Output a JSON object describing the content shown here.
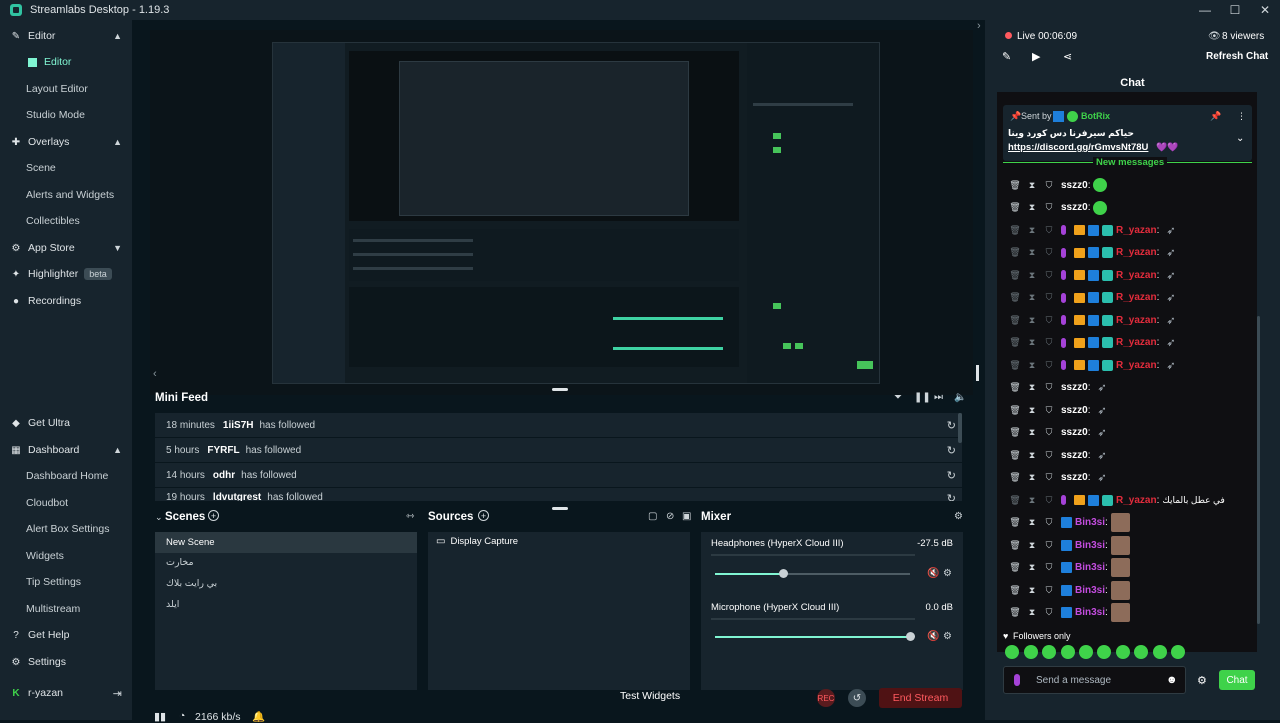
{
  "app": {
    "title": "Streamlabs Desktop - 1.19.3"
  },
  "sidebar": {
    "editor": "Editor",
    "editor_sub": "Editor",
    "layout_editor": "Layout Editor",
    "studio_mode": "Studio Mode",
    "overlays": "Overlays",
    "scene": "Scene",
    "alerts_widgets": "Alerts and Widgets",
    "collectibles": "Collectibles",
    "app_store": "App Store",
    "highlighter": "Highlighter",
    "highlighter_badge": "beta",
    "recordings": "Recordings",
    "get_ultra": "Get Ultra",
    "dashboard": "Dashboard",
    "dashboard_home": "Dashboard Home",
    "cloudbot": "Cloudbot",
    "alert_box": "Alert Box Settings",
    "widgets": "Widgets",
    "tip_settings": "Tip Settings",
    "multistream": "Multistream",
    "get_help": "Get Help",
    "settings": "Settings",
    "user": "r-yazan"
  },
  "minifeed": {
    "title": "Mini Feed",
    "rows": [
      {
        "time": "18 minutes",
        "user": "1iiS7H",
        "action": "has followed"
      },
      {
        "time": "5 hours",
        "user": "FYRFL",
        "action": "has followed"
      },
      {
        "time": "14 hours",
        "user": "odhr",
        "action": "has followed"
      },
      {
        "time": "19 hours",
        "user": "ldvutgrest",
        "action": "has followed"
      }
    ]
  },
  "scenes": {
    "title": "Scenes",
    "items": [
      "New Scene",
      "مخارت",
      "بي رايت بلاك",
      "ايلد"
    ]
  },
  "sources": {
    "title": "Sources",
    "items": [
      "Display Capture"
    ]
  },
  "mixer": {
    "title": "Mixer",
    "channels": [
      {
        "name": "Headphones (HyperX Cloud III)",
        "db": "-27.5 dB",
        "level": 0.35
      },
      {
        "name": "Microphone (HyperX Cloud III)",
        "db": "0.0 dB",
        "level": 1.0
      }
    ]
  },
  "footer": {
    "bitrate": "2166 kb/s",
    "test_widgets": "Test Widgets",
    "rec": "REC",
    "end_stream": "End Stream"
  },
  "stream": {
    "live": "Live 00:06:09",
    "viewers": "8 viewers",
    "refresh_chat": "Refresh Chat"
  },
  "chat": {
    "title": "Chat",
    "pinned_sent_by": "Sent by",
    "pinned_user": "BotRix",
    "pinned_text": "حياكم سيرفرنا دس كورد وينا",
    "pinned_link": "https://discord.gg/rGmvsNt78U",
    "new_messages": "New messages",
    "followers_only": "Followers only",
    "input_placeholder": "Send a message",
    "send_button": "Chat",
    "messages": [
      {
        "user": "sszz0",
        "kind": "plain",
        "content": "blob"
      },
      {
        "user": "sszz0",
        "kind": "plain",
        "content": "blob"
      },
      {
        "user": "R_yazan",
        "kind": "owner",
        "content": "feather"
      },
      {
        "user": "R_yazan",
        "kind": "owner",
        "content": "feather"
      },
      {
        "user": "R_yazan",
        "kind": "owner",
        "content": "feather"
      },
      {
        "user": "R_yazan",
        "kind": "owner",
        "content": "feather"
      },
      {
        "user": "R_yazan",
        "kind": "owner",
        "content": "feather"
      },
      {
        "user": "R_yazan",
        "kind": "owner",
        "content": "feather"
      },
      {
        "user": "R_yazan",
        "kind": "owner",
        "content": "feather"
      },
      {
        "user": "sszz0",
        "kind": "plain",
        "content": "feather"
      },
      {
        "user": "sszz0",
        "kind": "plain",
        "content": "feather"
      },
      {
        "user": "sszz0",
        "kind": "plain",
        "content": "feather"
      },
      {
        "user": "sszz0",
        "kind": "plain",
        "content": "feather"
      },
      {
        "user": "sszz0",
        "kind": "plain",
        "content": "feather"
      },
      {
        "user": "R_yazan",
        "kind": "owner",
        "content": "text",
        "text": "في عطل بالمايك"
      },
      {
        "user": "Bin3si",
        "kind": "bin",
        "content": "avatar"
      },
      {
        "user": "Bin3si",
        "kind": "bin",
        "content": "avatar"
      },
      {
        "user": "Bin3si",
        "kind": "bin",
        "content": "avatar"
      },
      {
        "user": "Bin3si",
        "kind": "bin",
        "content": "avatar"
      },
      {
        "user": "Bin3si",
        "kind": "bin",
        "content": "avatar"
      }
    ]
  },
  "colors": {
    "accent": "#80f5d2",
    "green": "#3fd24a",
    "owner_name": "#e22c3c",
    "bin_name": "#c44de0",
    "end_stream_bg": "#4f1214"
  }
}
